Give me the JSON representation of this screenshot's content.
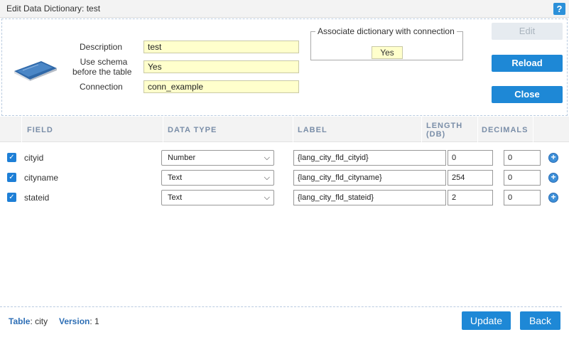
{
  "window": {
    "title": "Edit Data Dictionary: test",
    "help_label": "?"
  },
  "form": {
    "description_label": "Description",
    "description_value": "test",
    "schema_label_line1": "Use schema",
    "schema_label_line2": "before the table",
    "schema_value": "Yes",
    "connection_label": "Connection",
    "connection_value": "conn_example"
  },
  "associate": {
    "legend": "Associate dictionary with connection",
    "value": "Yes"
  },
  "actions": {
    "edit_label": "Edit",
    "reload_label": "Reload",
    "close_label": "Close"
  },
  "columns": {
    "field": "FIELD",
    "data_type": "DATA TYPE",
    "label": "LABEL",
    "length_line1": "LENGTH",
    "length_line2": "(DB)",
    "decimals": "DECIMALS"
  },
  "rows": [
    {
      "checked": true,
      "field": "cityid",
      "data_type": "Number",
      "label": "{lang_city_fld_cityid}",
      "length": "0",
      "decimals": "0"
    },
    {
      "checked": true,
      "field": "cityname",
      "data_type": "Text",
      "label": "{lang_city_fld_cityname}",
      "length": "254",
      "decimals": "0"
    },
    {
      "checked": true,
      "field": "stateid",
      "data_type": "Text",
      "label": "{lang_city_fld_stateid}",
      "length": "2",
      "decimals": "0"
    }
  ],
  "footer": {
    "table_key": "Table",
    "table_value": "city",
    "version_key": "Version",
    "version_value": "1",
    "update_label": "Update",
    "back_label": "Back"
  },
  "icons": {
    "checkbox": "check-icon",
    "dropdown": "chevron-down-icon",
    "add": "plus-circle-icon",
    "book": "book-icon"
  },
  "colors": {
    "accent": "#1e88d6",
    "readonly_field": "#ffffcc",
    "header_text": "#7a8ea8"
  }
}
